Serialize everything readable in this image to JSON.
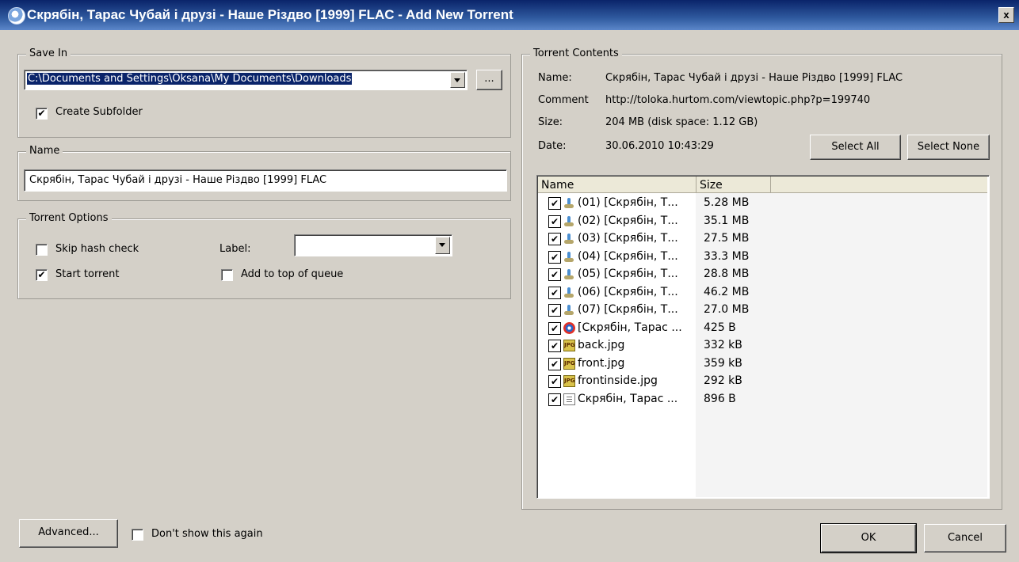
{
  "window": {
    "title": "Скрябін, Тарас Чубай і друзі - Наше Різдво [1999] FLAC - Add New Torrent",
    "close_label": "x"
  },
  "save_in": {
    "group_label": "Save In",
    "path": "C:\\Documents and Settings\\Oksana\\My Documents\\Downloads",
    "browse_label": "...",
    "create_subfolder_label": "Create Subfolder",
    "create_subfolder_checked": true
  },
  "name_group": {
    "group_label": "Name",
    "value": "Скрябін, Тарас Чубай і друзі - Наше Різдво [1999] FLAC"
  },
  "torrent_options": {
    "group_label": "Torrent Options",
    "skip_hash_label": "Skip hash check",
    "skip_hash_checked": false,
    "start_torrent_label": "Start torrent",
    "start_torrent_checked": true,
    "label_label": "Label:",
    "label_value": "",
    "add_top_label": "Add to top of queue",
    "add_top_checked": false
  },
  "contents": {
    "group_label": "Torrent Contents",
    "name_key": "Name:",
    "name_value": "Скрябін, Тарас Чубай і друзі - Наше Різдво [1999] FLAC",
    "comment_key": "Comment",
    "comment_value": "http://toloka.hurtom.com/viewtopic.php?p=199740",
    "size_key": "Size:",
    "size_value": "204 MB (disk space: 1.12 GB)",
    "date_key": "Date:",
    "date_value": "30.06.2010 10:43:29",
    "select_all_label": "Select All",
    "select_none_label": "Select None",
    "columns": [
      "Name",
      "Size"
    ],
    "files": [
      {
        "name": "(01) [Скрябін, Т...",
        "size": "5.28 MB",
        "icon": "audio-file-icon"
      },
      {
        "name": "(02) [Скрябін, Т...",
        "size": "35.1 MB",
        "icon": "audio-file-icon"
      },
      {
        "name": "(03) [Скрябін, Т...",
        "size": "27.5 MB",
        "icon": "audio-file-icon"
      },
      {
        "name": "(04) [Скрябін, Т...",
        "size": "33.3 MB",
        "icon": "audio-file-icon"
      },
      {
        "name": "(05) [Скрябін, Т...",
        "size": "28.8 MB",
        "icon": "audio-file-icon"
      },
      {
        "name": "(06) [Скрябін, Т...",
        "size": "46.2 MB",
        "icon": "audio-file-icon"
      },
      {
        "name": "(07) [Скрябін, Т...",
        "size": "27.0 MB",
        "icon": "audio-file-icon"
      },
      {
        "name": "[Скрябін, Тарас ...",
        "size": "425 B",
        "icon": "cue-file-icon"
      },
      {
        "name": "back.jpg",
        "size": "332 kB",
        "icon": "jpg-file-icon"
      },
      {
        "name": "front.jpg",
        "size": "359 kB",
        "icon": "jpg-file-icon"
      },
      {
        "name": "frontinside.jpg",
        "size": "292 kB",
        "icon": "jpg-file-icon"
      },
      {
        "name": "Скрябін, Тарас ...",
        "size": "896 B",
        "icon": "text-file-icon"
      }
    ]
  },
  "footer": {
    "advanced_label": "Advanced...",
    "dont_show_label": "Don't show this again",
    "dont_show_checked": false,
    "ok_label": "OK",
    "cancel_label": "Cancel"
  }
}
